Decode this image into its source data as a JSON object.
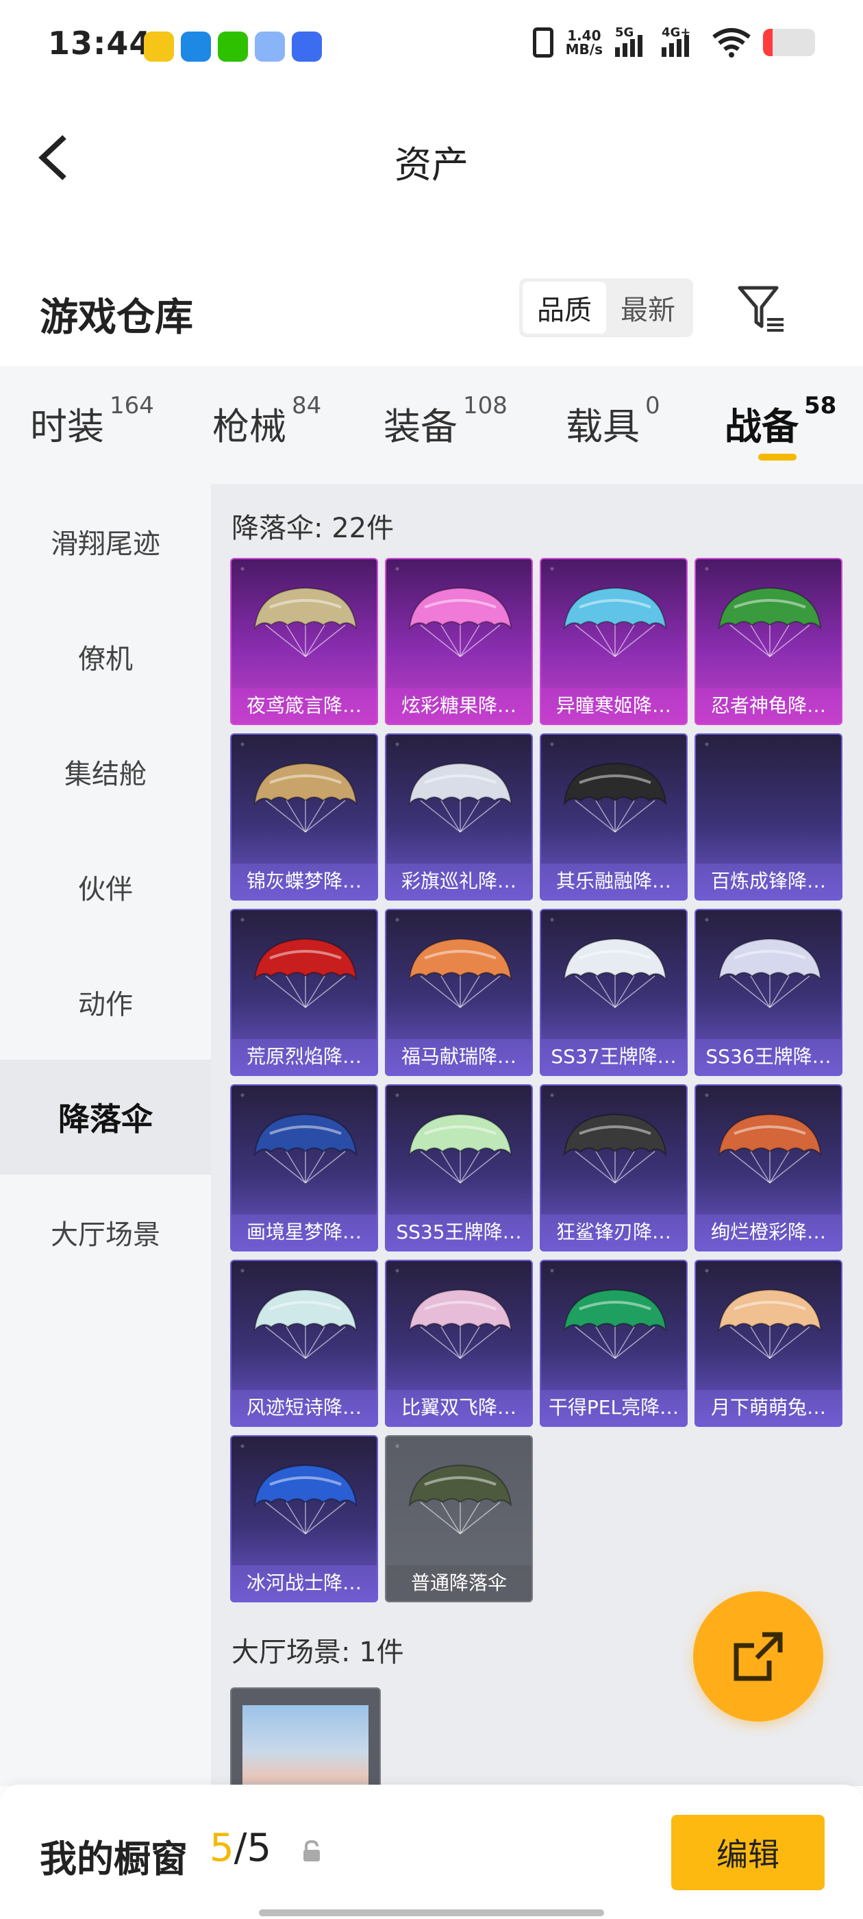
{
  "status_bar": {
    "time": "13:44",
    "speed_value": "1.40",
    "speed_unit": "MB/s",
    "net1": "5G",
    "net2": "4G+"
  },
  "header": {
    "title": "资产"
  },
  "warehouse": {
    "title": "游戏仓库",
    "sort_options": [
      "品质",
      "最新"
    ],
    "active_sort": "品质"
  },
  "tabs": [
    {
      "label": "时装",
      "count": "164"
    },
    {
      "label": "枪械",
      "count": "84"
    },
    {
      "label": "装备",
      "count": "108"
    },
    {
      "label": "载具",
      "count": "0"
    },
    {
      "label": "战备",
      "count": "58"
    }
  ],
  "active_tab": "战备",
  "sidebar": {
    "items": [
      "滑翔尾迹",
      "僚机",
      "集结舱",
      "伙伴",
      "动作",
      "降落伞",
      "大厅场景"
    ],
    "active": "降落伞"
  },
  "sections": {
    "parachute_label": "降落伞: 22件",
    "scene_label": "大厅场景: 1件"
  },
  "items": [
    {
      "name": "夜鸢箴言降…",
      "rarity": "legendary",
      "color": "#c9b98a"
    },
    {
      "name": "炫彩糖果降…",
      "rarity": "legendary",
      "color": "#f07ad8"
    },
    {
      "name": "异瞳寒姬降…",
      "rarity": "legendary",
      "color": "#5fc4e8"
    },
    {
      "name": "忍者神龟降…",
      "rarity": "legendary",
      "color": "#3a9a3e"
    },
    {
      "name": "锦灰蝶梦降…",
      "rarity": "epic",
      "color": "#c9a46a"
    },
    {
      "name": "彩旗巡礼降…",
      "rarity": "epic",
      "color": "#d8dde8"
    },
    {
      "name": "其乐融融降…",
      "rarity": "epic",
      "color": "#2b2b2b"
    },
    {
      "name": "百炼成锋降…",
      "rarity": "epic",
      "color": ""
    },
    {
      "name": "荒原烈焰降…",
      "rarity": "epic",
      "color": "#c81e1e"
    },
    {
      "name": "福马献瑞降…",
      "rarity": "epic",
      "color": "#e8864a"
    },
    {
      "name": "SS37王牌降…",
      "rarity": "epic",
      "color": "#e6ecf2"
    },
    {
      "name": "SS36王牌降…",
      "rarity": "epic",
      "color": "#d6d8ee"
    },
    {
      "name": "画境星梦降…",
      "rarity": "epic",
      "color": "#2a4da8"
    },
    {
      "name": "SS35王牌降…",
      "rarity": "epic",
      "color": "#bfe8b8"
    },
    {
      "name": "狂鲨锋刃降…",
      "rarity": "epic",
      "color": "#3a3a3a"
    },
    {
      "name": "绚烂橙彩降…",
      "rarity": "epic",
      "color": "#d4663a"
    },
    {
      "name": "风迹短诗降…",
      "rarity": "epic",
      "color": "#cfe8ea"
    },
    {
      "name": "比翼双飞降…",
      "rarity": "epic",
      "color": "#e6bcd8"
    },
    {
      "name": "干得PEL亮降…",
      "rarity": "epic",
      "color": "#1fa060"
    },
    {
      "name": "月下萌萌兔…",
      "rarity": "epic",
      "color": "#f0c090"
    },
    {
      "name": "冰河战士降…",
      "rarity": "epic",
      "color": "#2a5fd4"
    },
    {
      "name": "普通降落伞",
      "rarity": "common",
      "color": "#4e5a3e"
    }
  ],
  "showcase": {
    "label": "我的橱窗",
    "current": "5",
    "separator": "/",
    "total": "5",
    "edit_label": "编辑"
  },
  "colors": {
    "accent": "#f5b800",
    "fab": "#ffae1a",
    "legendary": "#c244c8",
    "epic": "#6c56c8",
    "common": "#666a73"
  }
}
